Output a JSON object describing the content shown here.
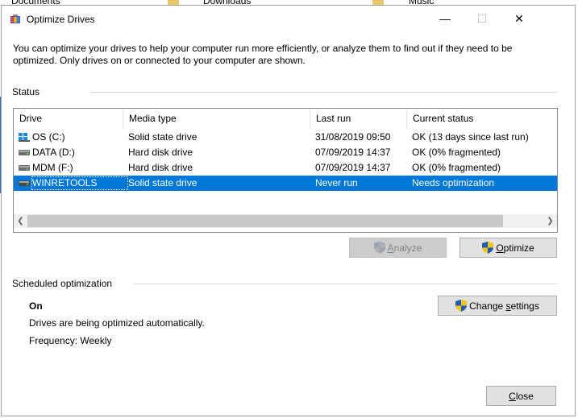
{
  "desktop": {
    "items": [
      "Documents",
      "Downloads",
      "Music"
    ]
  },
  "window": {
    "title": "Optimize Drives",
    "controls": {
      "minimize": "—",
      "maximize": "☐",
      "close": "✕"
    }
  },
  "description": "You can optimize your drives to help your computer run more efficiently, or analyze them to find out if they need to be optimized. Only drives on or connected to your computer are shown.",
  "status": {
    "title": "Status",
    "columns": [
      "Drive",
      "Media type",
      "Last run",
      "Current status"
    ],
    "rows": [
      {
        "drive": "OS (C:)",
        "media": "Solid state drive",
        "last_run": "31/08/2019 09:50",
        "status": "OK (13 days since last run)",
        "icon": "windows-drive-icon",
        "selected": false
      },
      {
        "drive": "DATA (D:)",
        "media": "Hard disk drive",
        "last_run": "07/09/2019 14:37",
        "status": "OK (0% fragmented)",
        "icon": "hard-drive-icon",
        "selected": false
      },
      {
        "drive": "MDM (F:)",
        "media": "Hard disk drive",
        "last_run": "07/09/2019 14:37",
        "status": "OK (0% fragmented)",
        "icon": "hard-drive-icon",
        "selected": false
      },
      {
        "drive": "WINRETOOLS",
        "media": "Solid state drive",
        "last_run": "Never run",
        "status": "Needs optimization",
        "icon": "hard-drive-icon",
        "selected": true
      }
    ]
  },
  "buttons": {
    "analyze_prefix": "",
    "analyze_accel": "A",
    "analyze_rest": "nalyze",
    "optimize_accel": "O",
    "optimize_rest": "ptimize",
    "change_prefix": "Change ",
    "change_accel": "s",
    "change_rest": "ettings",
    "close_accel": "C",
    "close_rest": "lose"
  },
  "scheduled": {
    "title": "Scheduled optimization",
    "state": "On",
    "line1": "Drives are being optimized automatically.",
    "frequency": "Frequency: Weekly"
  },
  "colors": {
    "selection": "#0078d7",
    "button_face": "#e1e1e1",
    "shield_blue": "#1d5db5",
    "shield_yellow": "#f2c417"
  }
}
